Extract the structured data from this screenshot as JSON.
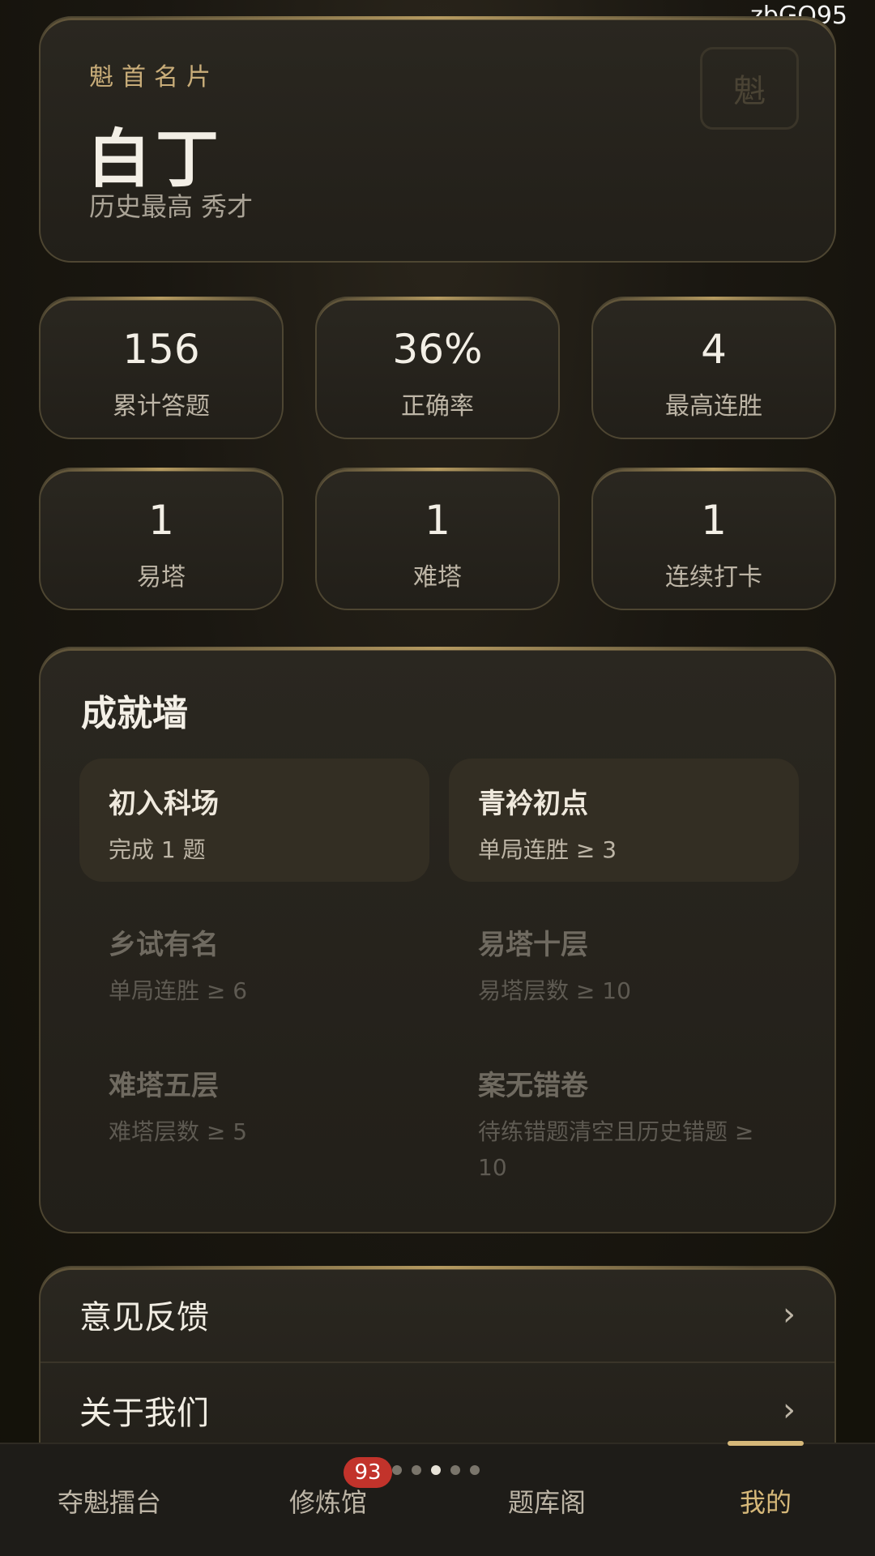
{
  "watermark": "zbGQ95",
  "profile": {
    "label": "魁首名片",
    "name": "白丁",
    "subtitle": "历史最高 秀才",
    "seal_char": "魁"
  },
  "stats": [
    {
      "value": "156",
      "label": "累计答题"
    },
    {
      "value": "36%",
      "label": "正确率"
    },
    {
      "value": "4",
      "label": "最高连胜"
    },
    {
      "value": "1",
      "label": "易塔"
    },
    {
      "value": "1",
      "label": "难塔"
    },
    {
      "value": "1",
      "label": "连续打卡"
    }
  ],
  "achievements": {
    "title": "成就墙",
    "items": [
      {
        "title": "初入科场",
        "desc": "完成 1 题",
        "unlocked": true
      },
      {
        "title": "青衿初点",
        "desc": "单局连胜 ≥ 3",
        "unlocked": true
      },
      {
        "title": "乡试有名",
        "desc": "单局连胜 ≥ 6",
        "unlocked": false
      },
      {
        "title": "易塔十层",
        "desc": "易塔层数 ≥ 10",
        "unlocked": false
      },
      {
        "title": "难塔五层",
        "desc": "难塔层数 ≥ 5",
        "unlocked": false
      },
      {
        "title": "案无错卷",
        "desc": "待练错题清空且历史错题 ≥ 10",
        "unlocked": false
      }
    ]
  },
  "menu": {
    "feedback": "意见反馈",
    "about": "关于我们",
    "chevron": "›"
  },
  "tabbar": {
    "tabs": [
      {
        "label": "夺魁擂台"
      },
      {
        "label": "修炼馆"
      },
      {
        "label": "题库阁"
      },
      {
        "label": "我的"
      }
    ],
    "active_index": 3,
    "badge": "93",
    "page_dots": {
      "count": 5,
      "active": 2
    }
  },
  "colors": {
    "accent": "#d6b879",
    "badge": "#c2332b",
    "background": "#17150f"
  }
}
